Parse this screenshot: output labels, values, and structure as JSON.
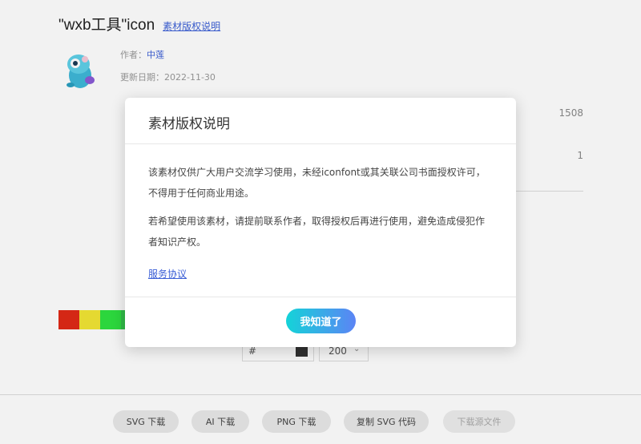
{
  "header": {
    "title": "\"wxb工具\"icon",
    "copyright_link": "素材版权说明"
  },
  "meta": {
    "author_label": "作者：",
    "author_name": "中莲",
    "updated_label": "更新日期：",
    "updated_value": "2022-11-30"
  },
  "stats": {
    "value_1": "1508",
    "value_2": "1"
  },
  "palette": [
    "#e02a17",
    "#f2e534",
    "#2fe241",
    "#33c24b"
  ],
  "editor": {
    "hash": "#",
    "chip_color": "#333333",
    "size": "200"
  },
  "actions": {
    "svg_download": "SVG 下载",
    "ai_download": "AI 下载",
    "png_download": "PNG 下载",
    "copy_svg": "复制 SVG 代码",
    "source_download": "下载源文件"
  },
  "modal": {
    "title": "素材版权说明",
    "para_1": "该素材仅供广大用户交流学习使用，未经iconfont或其关联公司书面授权许可，不得用于任何商业用途。",
    "para_2": "若希望使用该素材，请提前联系作者，取得授权后再进行使用，避免造成侵犯作者知识产权。",
    "service_link": "服务协议",
    "ok_button": "我知道了"
  }
}
